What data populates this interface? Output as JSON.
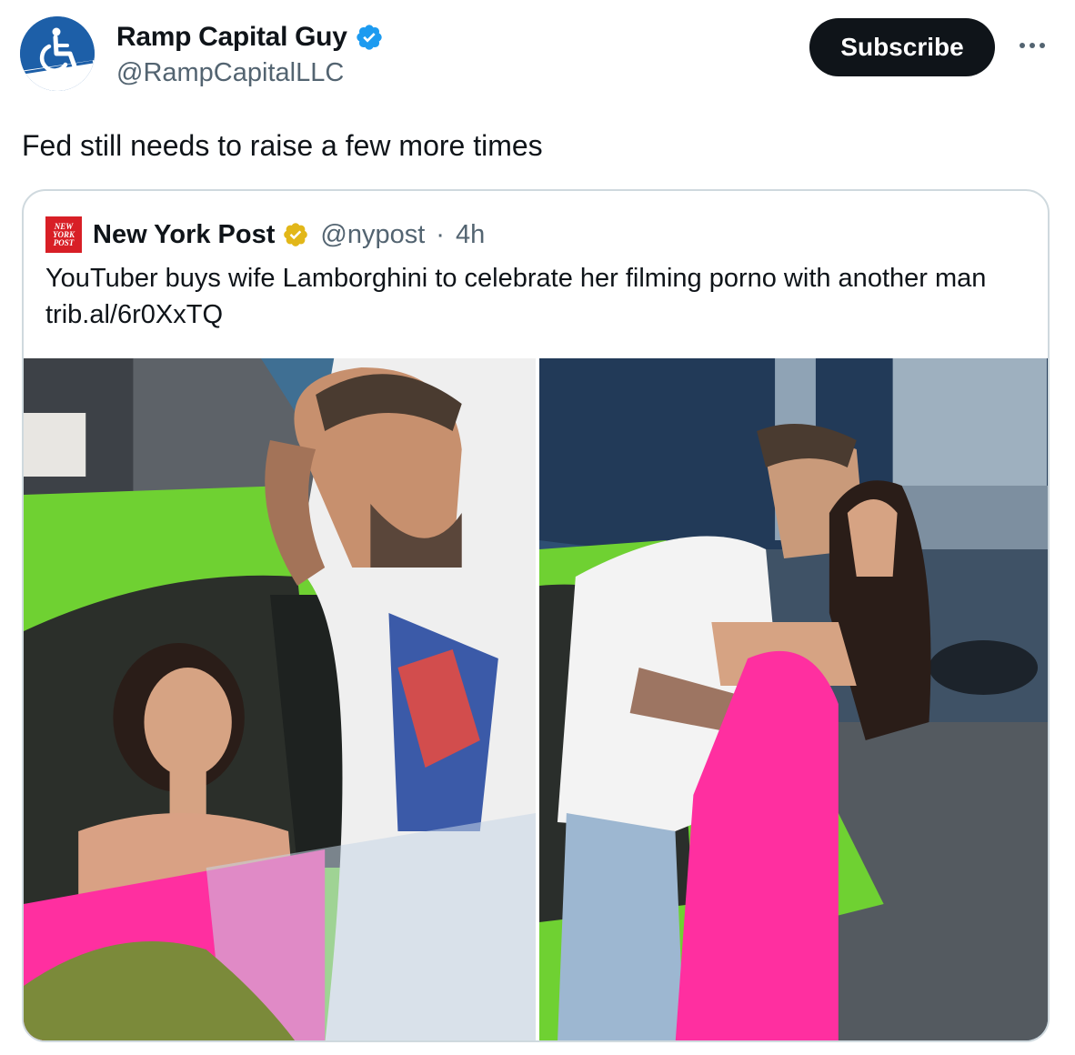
{
  "author": {
    "display_name": "Ramp Capital Guy",
    "handle": "@RampCapitalLLC",
    "avatar_icon": "wheelchair-icon",
    "verified_icon": "verified-badge-icon",
    "avatar_color": "#1d5fa8"
  },
  "actions": {
    "subscribe_label": "Subscribe",
    "more_icon": "more-icon"
  },
  "tweet": {
    "text": "Fed still needs to raise a few more times"
  },
  "quoted": {
    "logo_text": "NEW YORK POST",
    "display_name": "New York Post",
    "verified_icon": "gold-verified-badge-icon",
    "handle": "@nypost",
    "separator": "·",
    "time": "4h",
    "text": "YouTuber buys wife Lamborghini to celebrate her filming porno with another man trib.al/6r0XxTQ",
    "images": [
      "photo-man-woman-lamborghini",
      "photo-couple-kissing"
    ]
  },
  "colors": {
    "brand_blue": "#1d9bf0",
    "nypost_red": "#d81f26",
    "lambo_green": "#6fd132",
    "dress_pink": "#ff2fa0",
    "text_secondary": "#536471"
  }
}
